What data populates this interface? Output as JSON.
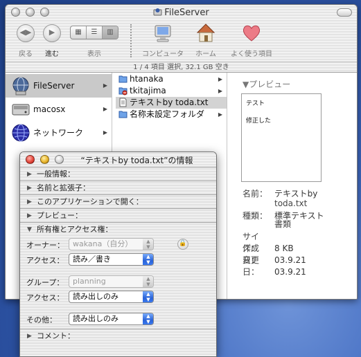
{
  "window": {
    "title": "FileServer",
    "status": "1 / 4 項目 選択, 32.1 GB 空き"
  },
  "toolbar": {
    "back_label": "戻る",
    "forward_label": "進む",
    "view_label": "表示",
    "computer_label": "コンピュータ",
    "home_label": "ホーム",
    "favorites_label": "よく使う項目"
  },
  "volumes": [
    {
      "label": "FileServer",
      "selected": true
    },
    {
      "label": "macosx",
      "selected": false
    },
    {
      "label": "ネットワーク",
      "selected": false
    }
  ],
  "folder_items": [
    {
      "label": "htanaka",
      "kind": "folder",
      "has_arrow": true
    },
    {
      "label": "tkitajima",
      "kind": "folder-restricted",
      "has_arrow": true
    },
    {
      "label": "テキストby toda.txt",
      "kind": "text-file",
      "has_arrow": false,
      "selected": true
    },
    {
      "label": "名称未設定フォルダ",
      "kind": "folder",
      "has_arrow": true
    }
  ],
  "preview": {
    "header": "▼プレビュー",
    "content_line1": "テスト",
    "content_line2": "修正した",
    "name_key": "名前：",
    "name_value_1": "テキストby",
    "name_value_2": "toda.txt",
    "kind_key": "種類：",
    "kind_value_1": "標準テキスト",
    "kind_value_2": "書類",
    "size_key": "サイズ：",
    "size_value": "8 KB",
    "created_key": "作成日：",
    "created_value": "03.9.21",
    "modified_key": "変更日：",
    "modified_value": "03.9.21"
  },
  "info": {
    "title": "“テキストby toda.txt”の情報",
    "sections": {
      "general": "一般情報：",
      "name_ext": "名前と拡張子：",
      "open_with": "このアプリケーションで開く：",
      "preview": "プレビュー：",
      "ownership": "所有権とアクセス権：",
      "comments": "コメント："
    },
    "owner_label": "オーナー：",
    "owner_value": "wakana（自分）",
    "owner_access_label": "アクセス：",
    "owner_access_value": "読み／書き",
    "group_label": "グループ：",
    "group_value": "planning",
    "group_access_label": "アクセス：",
    "group_access_value": "読み出しのみ",
    "others_label": "その他：",
    "others_value": "読み出しのみ"
  },
  "colors": {
    "desktop": "#3d67be",
    "selection": "#c9c9c9",
    "popup_arrow": "#2a63d8"
  }
}
